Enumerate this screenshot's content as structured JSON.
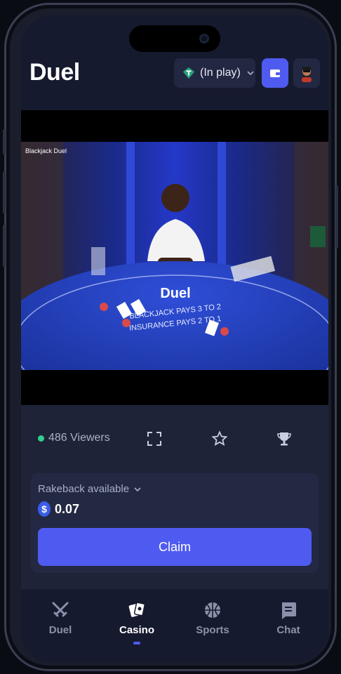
{
  "header": {
    "logo": "Duel",
    "currency_selector": {
      "label": "(In play)",
      "icon": "tether-icon"
    },
    "wallet_icon": "wallet-icon",
    "avatar_icon": "avatar"
  },
  "video": {
    "table_name": "Blackjack Duel",
    "table_brand": "Duel",
    "felt_text_1": "BLACKJACK PAYS 3 TO 2",
    "felt_text_2": "INSURANCE PAYS 2 TO 1"
  },
  "stream_bar": {
    "viewers": "486 Viewers",
    "icons": [
      "fullscreen-icon",
      "star-icon",
      "trophy-icon"
    ]
  },
  "rakeback": {
    "label": "Rakeback available",
    "amount": "0.07",
    "currency_symbol": "$",
    "claim_label": "Claim"
  },
  "nav": {
    "items": [
      {
        "label": "Duel",
        "icon": "swords-icon",
        "active": false
      },
      {
        "label": "Casino",
        "icon": "cards-icon",
        "active": true
      },
      {
        "label": "Sports",
        "icon": "basketball-icon",
        "active": false
      },
      {
        "label": "Chat",
        "icon": "chat-icon",
        "active": false
      }
    ]
  },
  "colors": {
    "accent": "#4f5bf0",
    "online": "#2fd08f",
    "panel": "#1e2338",
    "header": "#161a2e"
  }
}
